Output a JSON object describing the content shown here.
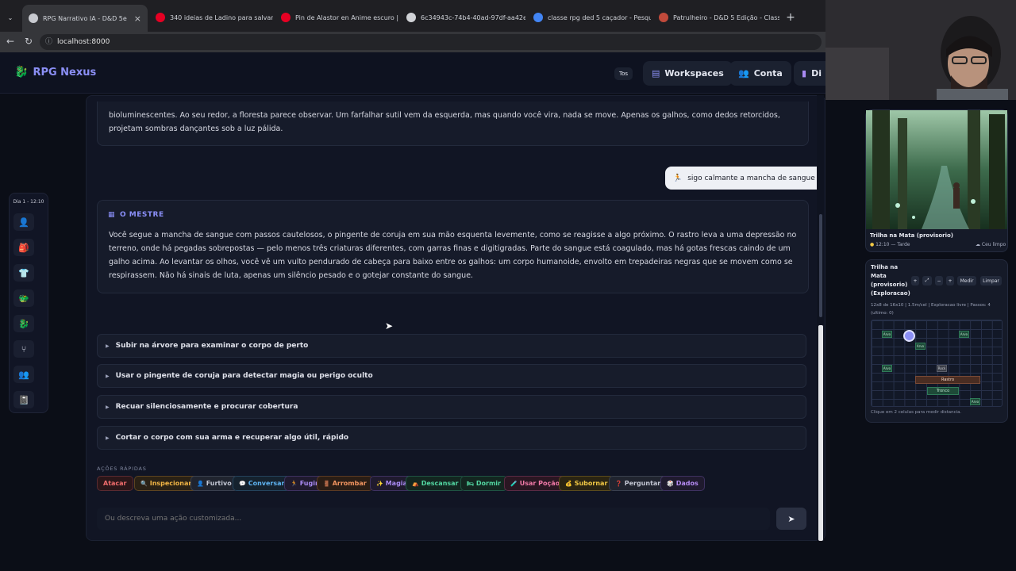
{
  "browser": {
    "tabs": [
      {
        "label": "RPG Narrativo IA - D&D 5e",
        "color": "#c8cad0"
      },
      {
        "label": "340 ideias de Ladino para salvar h",
        "color": "#e60023"
      },
      {
        "label": "Pin de Alastor en Anime escuro | A",
        "color": "#e60023"
      },
      {
        "label": "6c34943c-74b4-40ad-97df-aa42e",
        "color": "#d0d2d6"
      },
      {
        "label": "classe rpg ded 5 caçador - Pesquis",
        "color": "#4285f4"
      },
      {
        "label": "Patrulheiro - D&D 5 Edição - Class",
        "color": "#c14a3b"
      }
    ],
    "url": "localhost:8000"
  },
  "header": {
    "brand": "RPG Nexus",
    "tos": "Tos",
    "workspaces": "Workspaces",
    "conta": "Conta",
    "cut_label": "Di"
  },
  "rail": {
    "title": "Dia 1 - 12:10",
    "icons": [
      "user-icon",
      "backpack-icon",
      "shirt-icon",
      "dragon-icon",
      "dragon-head-icon",
      "tree-icon",
      "group-icon",
      "book-icon"
    ]
  },
  "narrative": {
    "first": "bioluminescentes. Ao seu redor, a floresta parece observar. Um farfalhar sutil vem da esquerda, mas quando você vira, nada se move. Apenas os galhos, como dedos retorcidos, projetam sombras dançantes sob a luz pálida.",
    "user_action": "sigo calmante a mancha de sangue",
    "master_label": "O MESTRE",
    "master_text": "Você segue a mancha de sangue com passos cautelosos, o pingente de coruja em sua mão esquenta levemente, como se reagisse a algo próximo. O rastro leva a uma depressão no terreno, onde há pegadas sobrepostas — pelo menos três criaturas diferentes, com garras finas e digitigradas. Parte do sangue está coagulado, mas há gotas frescas caindo de um galho acima. Ao levantar os olhos, você vê um vulto pendurado de cabeça para baixo entre os galhos: um corpo humanoide, envolto em trepadeiras negras que se movem como se respirassem. Não há sinais de luta, apenas um silêncio pesado e o gotejar constante do sangue."
  },
  "choices": [
    "Subir na árvore para examinar o corpo de perto",
    "Usar o pingente de coruja para detectar magia ou perigo oculto",
    "Recuar silenciosamente e procurar cobertura",
    "Cortar o corpo com sua arma e recuperar algo útil, rápido"
  ],
  "quick_actions": {
    "title": "AÇÕES RÁPIDAS",
    "items": [
      {
        "label": "Atacar",
        "icon": "",
        "color": "#f26d6d",
        "bg": "#2a1619",
        "border": "#5a2a30"
      },
      {
        "label": "Inspecionar",
        "icon": "🔍",
        "color": "#f2b545",
        "bg": "#2a2115",
        "border": "#5d4420"
      },
      {
        "label": "Furtivo",
        "icon": "👤",
        "color": "#c4c8d4",
        "bg": "#20242f",
        "border": "#3a404f"
      },
      {
        "label": "Conversar",
        "icon": "💬",
        "color": "#5fb4f2",
        "bg": "#15222e",
        "border": "#24435c"
      },
      {
        "label": "Fugir",
        "icon": "🏃",
        "color": "#a98af2",
        "bg": "#1f1a2e",
        "border": "#3e3160"
      },
      {
        "label": "Arrombar",
        "icon": "🚪",
        "color": "#f29560",
        "bg": "#2a1d15",
        "border": "#5b3a22"
      },
      {
        "label": "Magia",
        "icon": "✨",
        "color": "#a98af2",
        "bg": "#1f1a2e",
        "border": "#3e3160"
      },
      {
        "label": "Descansar",
        "icon": "⛺",
        "color": "#52d6a1",
        "bg": "#132620",
        "border": "#1f5342"
      },
      {
        "label": "Dormir",
        "icon": "🛏",
        "color": "#52d6a1",
        "bg": "#132620",
        "border": "#1f5342"
      },
      {
        "label": "Usar Poção",
        "icon": "🧪",
        "color": "#f27aa8",
        "bg": "#2a1622",
        "border": "#5a2a44"
      },
      {
        "label": "Subornar",
        "icon": "💰",
        "color": "#f2c945",
        "bg": "#2a2412",
        "border": "#5a4b1c"
      },
      {
        "label": "Perguntar",
        "icon": "❓",
        "color": "#c4c8d4",
        "bg": "#20242f",
        "border": "#3a404f"
      },
      {
        "label": "Dados",
        "icon": "🎲",
        "color": "#b58af2",
        "bg": "#1f1a2e",
        "border": "#3e3160"
      }
    ]
  },
  "input": {
    "placeholder": "Ou descreva uma ação customizada..."
  },
  "scene": {
    "title": "Trilha na Mata (provisorio)",
    "time": "12:10 — Tarde",
    "weather": "Ceu limpo"
  },
  "map": {
    "title": "Trilha na Mata (provisorio) (Exploracao)",
    "buttons": [
      "+",
      "⤢",
      "−",
      "+",
      "Medir",
      "Limpar"
    ],
    "info": "12x8 de 16x10 | 1.5m/cel | Exploracao livre | Passos: 4 (ultimo: 0)",
    "cells": [
      "Arvo",
      "Arvo",
      "Arvo",
      "Arvo",
      "Rock",
      "Rastro",
      "Tronco",
      "Arvo"
    ],
    "hint": "Clique em 2 celulas para medir distancia."
  },
  "colors": {
    "accent": "#8b8ff5",
    "page_bg": "#0b0e17"
  }
}
